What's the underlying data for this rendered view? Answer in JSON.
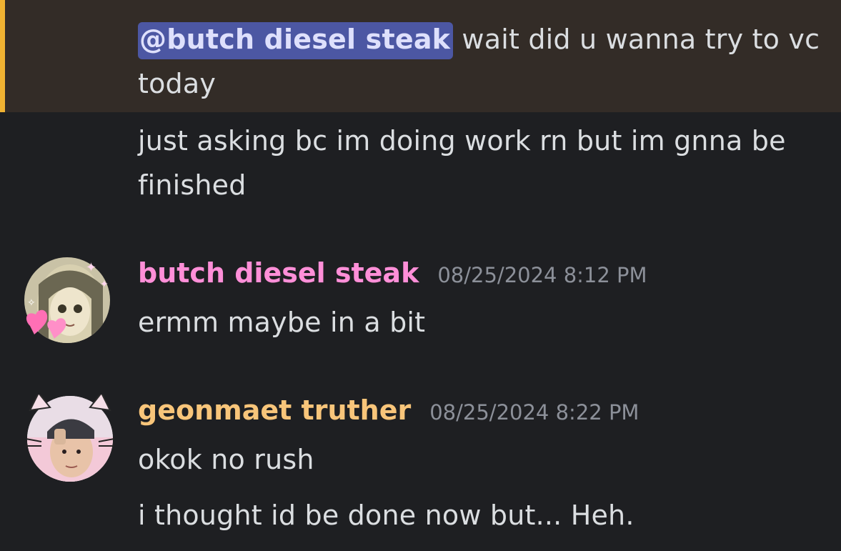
{
  "messages": {
    "m1": {
      "mention": "@butch diesel steak",
      "line1_rest": " wait did u wanna try to vc",
      "line2": "today"
    },
    "m2": {
      "line1": "just asking bc im doing work rn but im gnna be",
      "line2": "finished"
    },
    "m3": {
      "username": "butch diesel steak",
      "timestamp": "08/25/2024 8:12 PM",
      "text": "ermm maybe in a bit"
    },
    "m4": {
      "username": "geonmaet truther",
      "timestamp": "08/25/2024 8:22 PM",
      "text": "okok no rush"
    },
    "m5": {
      "text": "i thought id be done now but... Heh."
    }
  },
  "colors": {
    "background": "#1e1f22",
    "mention_highlight": "#332c27",
    "mention_bar": "#f0b232",
    "mention_chip": "#4c57a3",
    "username_pink": "#ff8fd8",
    "username_orange": "#f8c57a",
    "timestamp": "#8c9099",
    "text": "#dbdee1"
  },
  "avatars": {
    "butch_diesel_steak": "avatar-illustrated-girl-with-hearts",
    "geonmaet_truther": "avatar-person-with-cat-ears"
  }
}
